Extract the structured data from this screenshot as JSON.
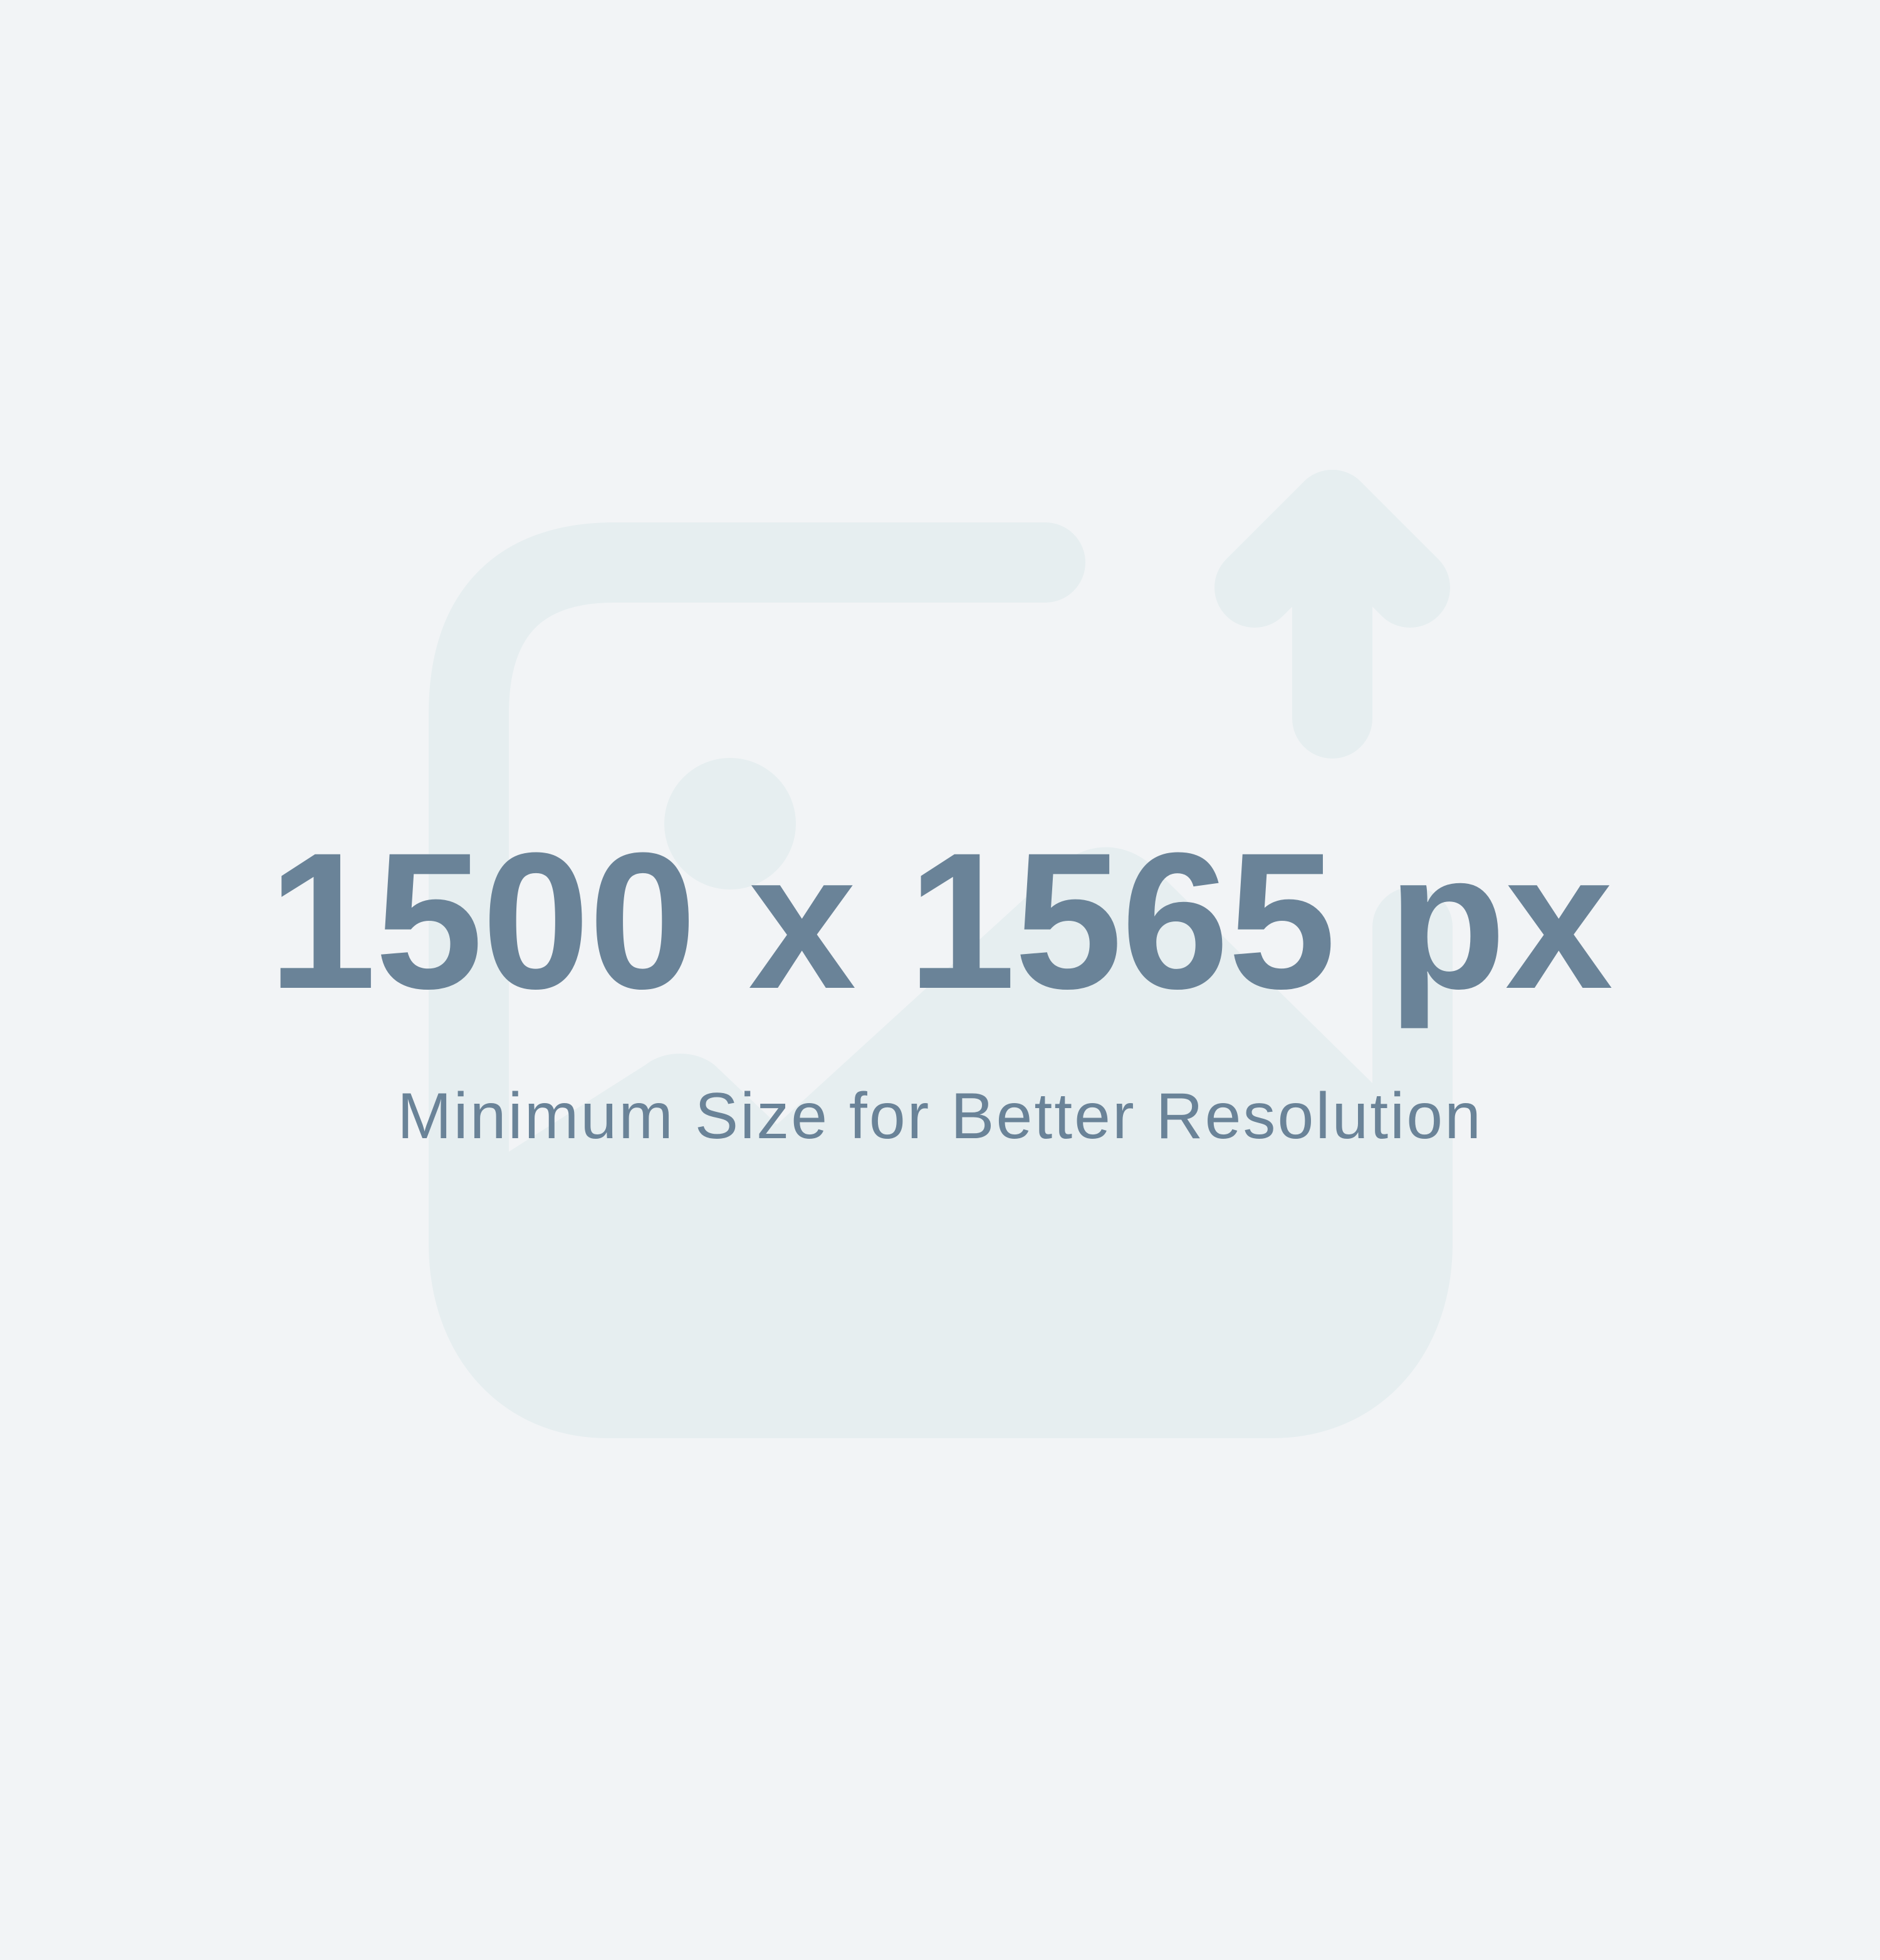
{
  "placeholder": {
    "dimensions_text": "1500 x 1565 px",
    "caption_text": "Minimum Size for Better Resolution",
    "icon_name": "image-upload-icon",
    "colors": {
      "background": "#f2f4f6",
      "icon": "#e6eef0",
      "text": "#6a8398"
    }
  }
}
